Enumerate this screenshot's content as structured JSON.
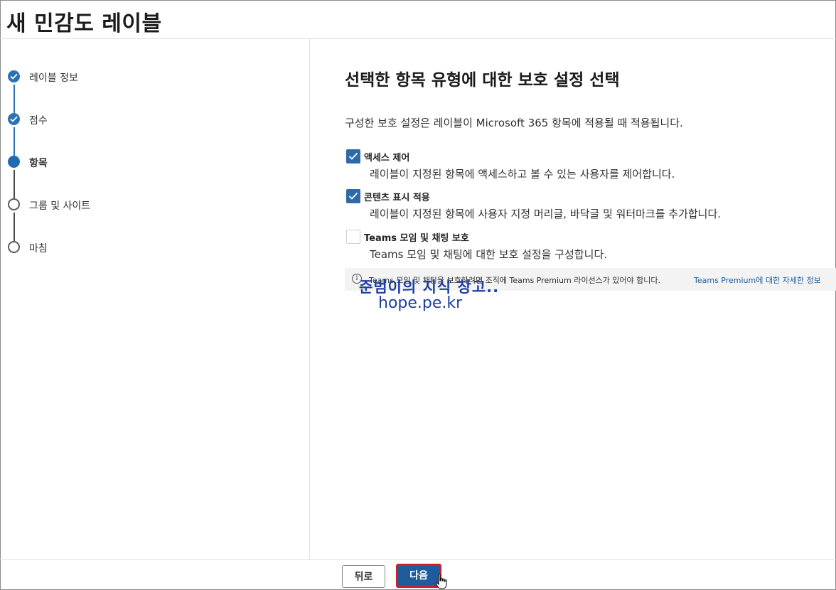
{
  "page_title": "새 민감도 레이블",
  "steps": [
    {
      "label": "레이블 정보",
      "state": "done"
    },
    {
      "label": "점수",
      "state": "done"
    },
    {
      "label": "항목",
      "state": "current"
    },
    {
      "label": "그룹 및 사이트",
      "state": "todo"
    },
    {
      "label": "마침",
      "state": "todo"
    }
  ],
  "main": {
    "heading": "선택한 항목 유형에 대한 보호 설정 선택",
    "description": "구성한 보호 설정은 레이블이 Microsoft 365 항목에 적용될 때 적용됩니다.",
    "options": [
      {
        "title": "액세스 제어",
        "subtitle": "레이블이 지정된 항목에 액세스하고 볼 수 있는 사용자를 제어합니다.",
        "checked": true
      },
      {
        "title": "콘텐츠 표시 적용",
        "subtitle": "레이블이 지정된 항목에 사용자 지정 머리글, 바닥글 및 워터마크를 추가합니다.",
        "checked": true
      },
      {
        "title": "Teams 모임 및 채팅 보호",
        "subtitle": "Teams 모임 및 채팅에 대한 보호 설정을 구성합니다.",
        "checked": false
      }
    ],
    "info": {
      "text": "Teams 모임 및 채팅을 보호하려면 조직에 Teams Premium 라이선스가 있어야 합니다.",
      "link": "Teams Premium에 대한 자세한 정보"
    }
  },
  "watermark": {
    "line1": "준범이의 지식 창고..",
    "line2": "hope.pe.kr"
  },
  "footer": {
    "back_label": "뒤로",
    "next_label": "다음"
  },
  "colors": {
    "accent": "#2a72b5",
    "primary_button": "#1f5c9e",
    "highlight_border": "#c9212b"
  }
}
